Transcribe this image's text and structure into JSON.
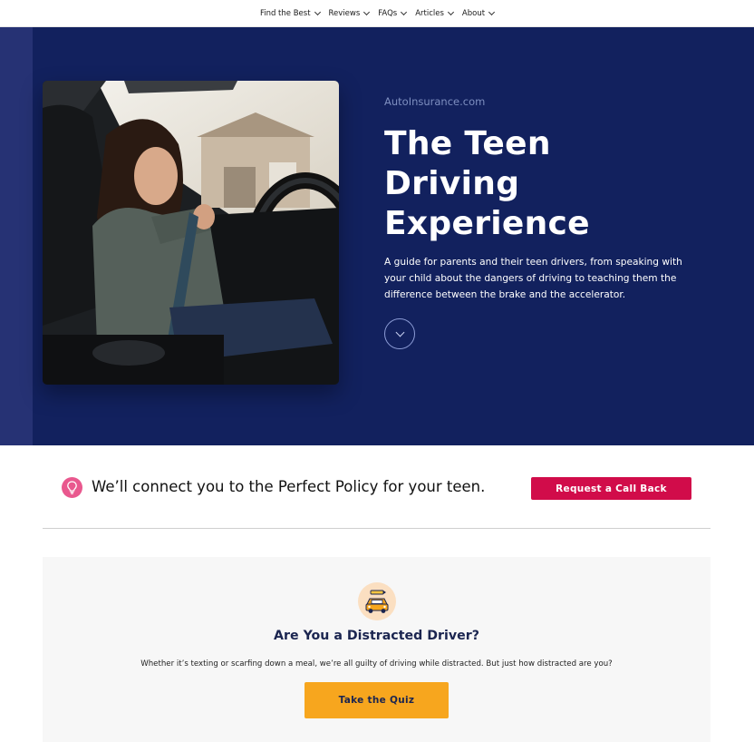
{
  "nav": {
    "items": [
      {
        "label": "Find the Best"
      },
      {
        "label": "Reviews"
      },
      {
        "label": "FAQs"
      },
      {
        "label": "Articles"
      },
      {
        "label": "About"
      }
    ]
  },
  "hero": {
    "brand": "AutoInsurance.com",
    "title": "The Teen Driving Experience",
    "description": "A guide for parents and their teen drivers, from speaking with your child about the dangers of driving to teaching them the difference between the brake and the accelerator.",
    "photo_icon": "teen-buckling-seatbelt-photo",
    "scroll_icon": "chevron-down-icon"
  },
  "cta": {
    "icon": "lightbulb-icon",
    "text": "We’ll connect you to the Perfect Policy for your teen.",
    "button_label": "Request a Call Back"
  },
  "quiz": {
    "icon": "distracted-car-icon",
    "title": "Are You a Distracted Driver?",
    "text": "Whether it’s texting or scarfing down a meal, we’re all guilty of driving while distracted. But just how distracted are you?",
    "button_label": "Take the Quiz"
  },
  "colors": {
    "hero_bg": "#12215e",
    "hero_stripe": "#263274",
    "cta_button": "#d10c4a",
    "quiz_button": "#f7a61e",
    "quiz_icon_bg": "#fbdfc1",
    "lightbulb_bg": "#e9588e"
  }
}
